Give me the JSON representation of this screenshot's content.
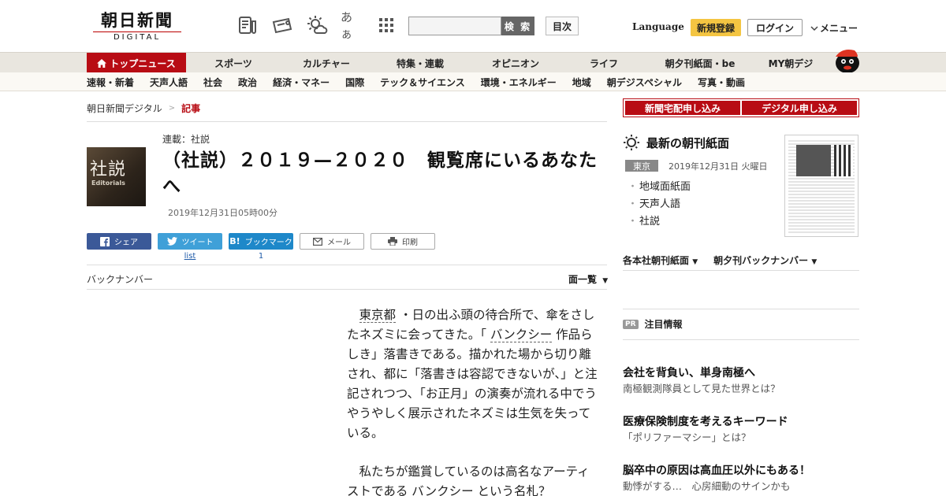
{
  "header": {
    "logo_main": "朝日新聞",
    "logo_sub": "DIGITAL",
    "search_button": "検 索",
    "toc_button": "目次",
    "language": "Language",
    "register": "新規登録",
    "login": "ログイン",
    "menu": "メニュー",
    "icons": [
      "news-icon",
      "coupon-icon",
      "weather-icon",
      "font-size-icon",
      "grid-icon"
    ],
    "font_size_glyph": "あぁ"
  },
  "nav_main": {
    "top": "トップニュース",
    "items": [
      "スポーツ",
      "カルチャー",
      "特集・連載",
      "オピニオン",
      "ライフ",
      "朝夕刊紙面・be",
      "MY朝デジ"
    ]
  },
  "nav_sub": {
    "items": [
      "速報・新着",
      "天声人語",
      "社会",
      "政治",
      "経済・マネー",
      "国際",
      "テック＆サイエンス",
      "環境・エネルギー",
      "地域",
      "朝デジスペシャル",
      "写真・動画"
    ]
  },
  "breadcrumb": {
    "home": "朝日新聞デジタル",
    "sep": ">",
    "current": "記事"
  },
  "article": {
    "badge_kanji": "社説",
    "badge_en": "Editorials",
    "series": "連載：社説",
    "title": "（社説）２０１９—２０２０　観覧席にいるあなたへ",
    "date": "2019年12月31日05時00分",
    "share": {
      "facebook": "シェア",
      "twitter": "ツイート",
      "hatena": "ブックマーク",
      "hatena_icon": "B!",
      "mail": "メール",
      "print": "印刷",
      "twitter_count": "list",
      "hatena_count": "1"
    },
    "backnumber": "バックナンバー",
    "menpage": "面一覧",
    "p1": {
      "a": "東京都",
      "b": "・日の出ふ頭の待合所で、傘をさしたネズミに会ってきた。「",
      "c": "バンクシー",
      "d": "作品らしき」落書きである。描かれた場から切り離され、都に「落書きは容認できないが、」と注記されつつ、「お正月」の演奏が流れる中でうやうやしく展示されたネズミは生気を失っている。"
    },
    "p2": {
      "a": "私たちが鑑賞しているのは高名なアーティストである",
      "b": "バンクシー",
      "c": "という名札？"
    }
  },
  "sidebar": {
    "btn_home_delivery": "新聞宅配申し込み",
    "btn_digital": "デジタル申し込み",
    "paper_title": "最新の朝刊紙面",
    "region": "東京",
    "paper_date": "2019年12月31日 火曜日",
    "paper_links": [
      "地域面紙面",
      "天声人語",
      "社説"
    ],
    "links": [
      "各本社朝刊紙面",
      "朝夕刊バックナンバー"
    ],
    "pr_badge": "PR",
    "pr_title": "注目情報",
    "pr_items": [
      {
        "title": "会社を背負い、単身南極へ",
        "sub": "南極観測隊員として見た世界とは？"
      },
      {
        "title": "医療保険制度を考えるキーワード",
        "sub": "「ポリファーマシー」とは？"
      },
      {
        "title": "脳卒中の原因は高血圧以外にもある！",
        "sub": "動悸がする…　心房細動のサインかも"
      }
    ]
  }
}
